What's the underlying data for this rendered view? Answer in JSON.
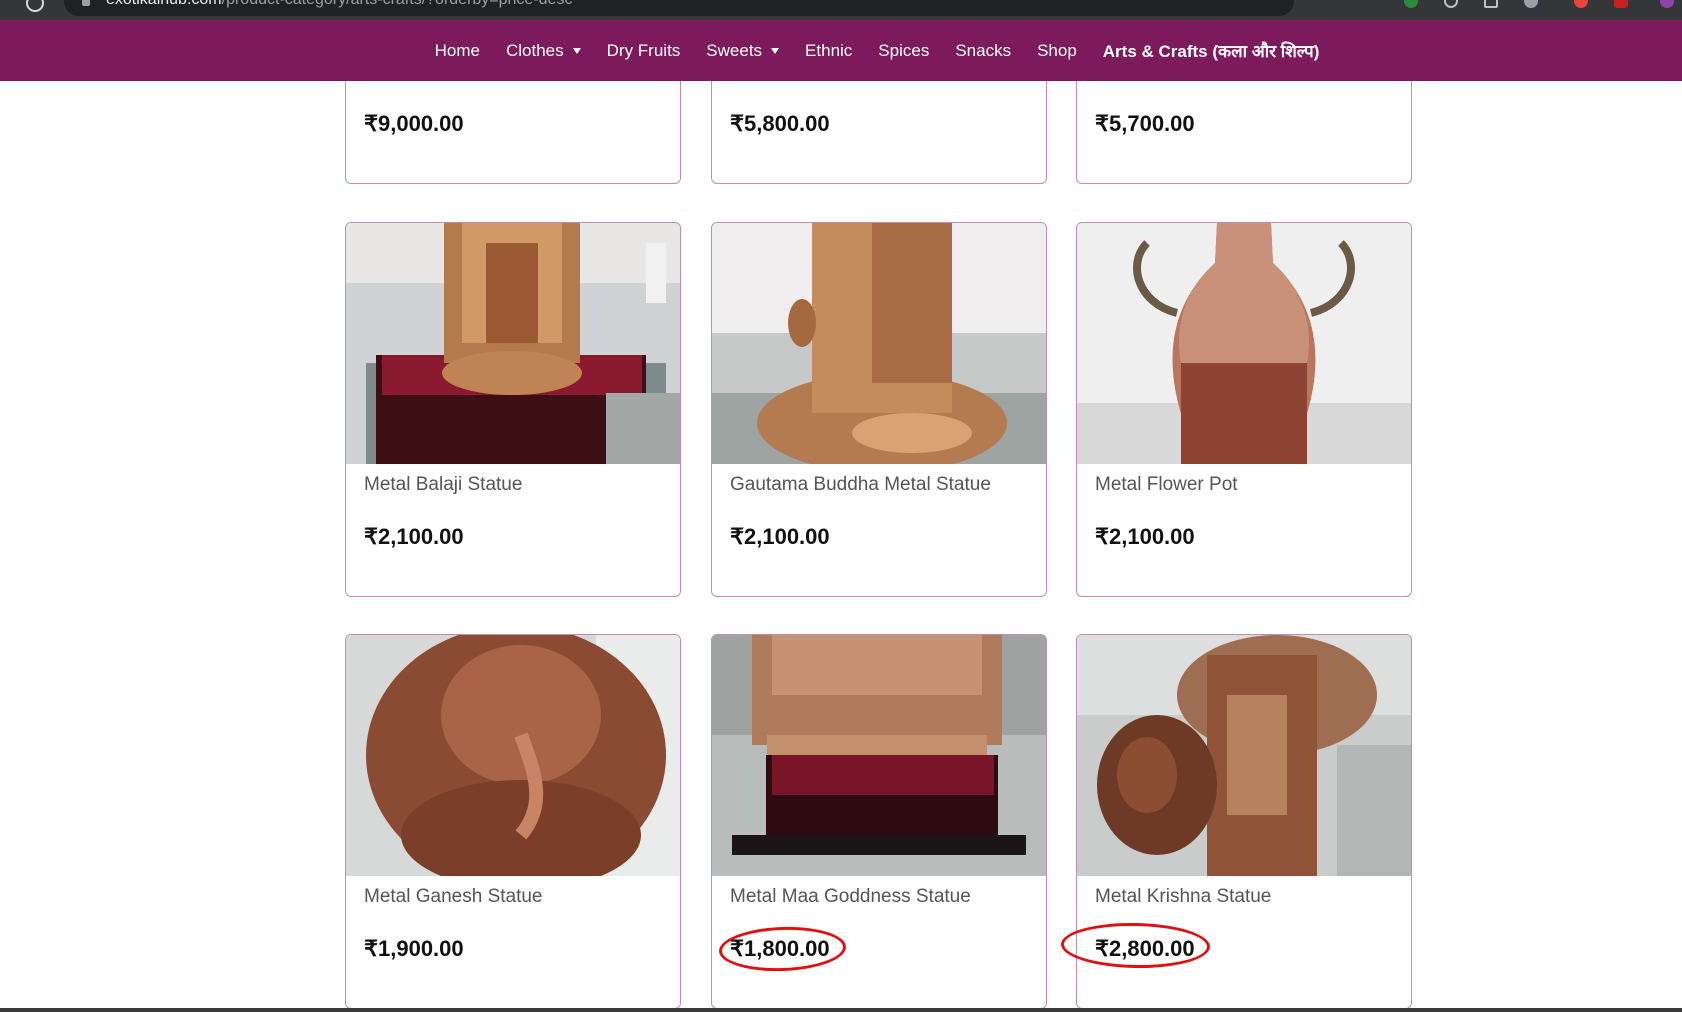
{
  "browser": {
    "url_host": "exotikalhub.com",
    "url_path": "/product-category/arts-crafts/?orderby=price-desc"
  },
  "nav": {
    "items": [
      {
        "label": "Home",
        "dropdown": false,
        "active": false
      },
      {
        "label": "Clothes",
        "dropdown": true,
        "active": false
      },
      {
        "label": "Dry Fruits",
        "dropdown": false,
        "active": false
      },
      {
        "label": "Sweets",
        "dropdown": true,
        "active": false
      },
      {
        "label": "Ethnic",
        "dropdown": false,
        "active": false
      },
      {
        "label": "Spices",
        "dropdown": false,
        "active": false
      },
      {
        "label": "Snacks",
        "dropdown": false,
        "active": false
      },
      {
        "label": "Shop",
        "dropdown": false,
        "active": false
      },
      {
        "label": "Arts & Crafts (कला और शिल्प)",
        "dropdown": false,
        "active": true
      }
    ],
    "bg_color": "#7c1a5c"
  },
  "products_row0": [
    {
      "price": "₹9,000.00"
    },
    {
      "price": "₹5,800.00"
    },
    {
      "price": "₹5,700.00"
    }
  ],
  "products": [
    {
      "title": "Metal Balaji Statue",
      "price": "₹2,100.00",
      "highlighted": false
    },
    {
      "title": "Gautama Buddha Metal Statue",
      "price": "₹2,100.00",
      "highlighted": false
    },
    {
      "title": "Metal Flower Pot",
      "price": "₹2,100.00",
      "highlighted": false
    },
    {
      "title": "Metal Ganesh Statue",
      "price": "₹1,900.00",
      "highlighted": false
    },
    {
      "title": "Metal Maa Goddness Statue",
      "price": "₹1,800.00",
      "highlighted": true
    },
    {
      "title": "Metal Krishna Statue",
      "price": "₹2,800.00",
      "highlighted": true
    }
  ],
  "colors": {
    "card_border": "#c58ab5",
    "annotation": "#e01010"
  }
}
